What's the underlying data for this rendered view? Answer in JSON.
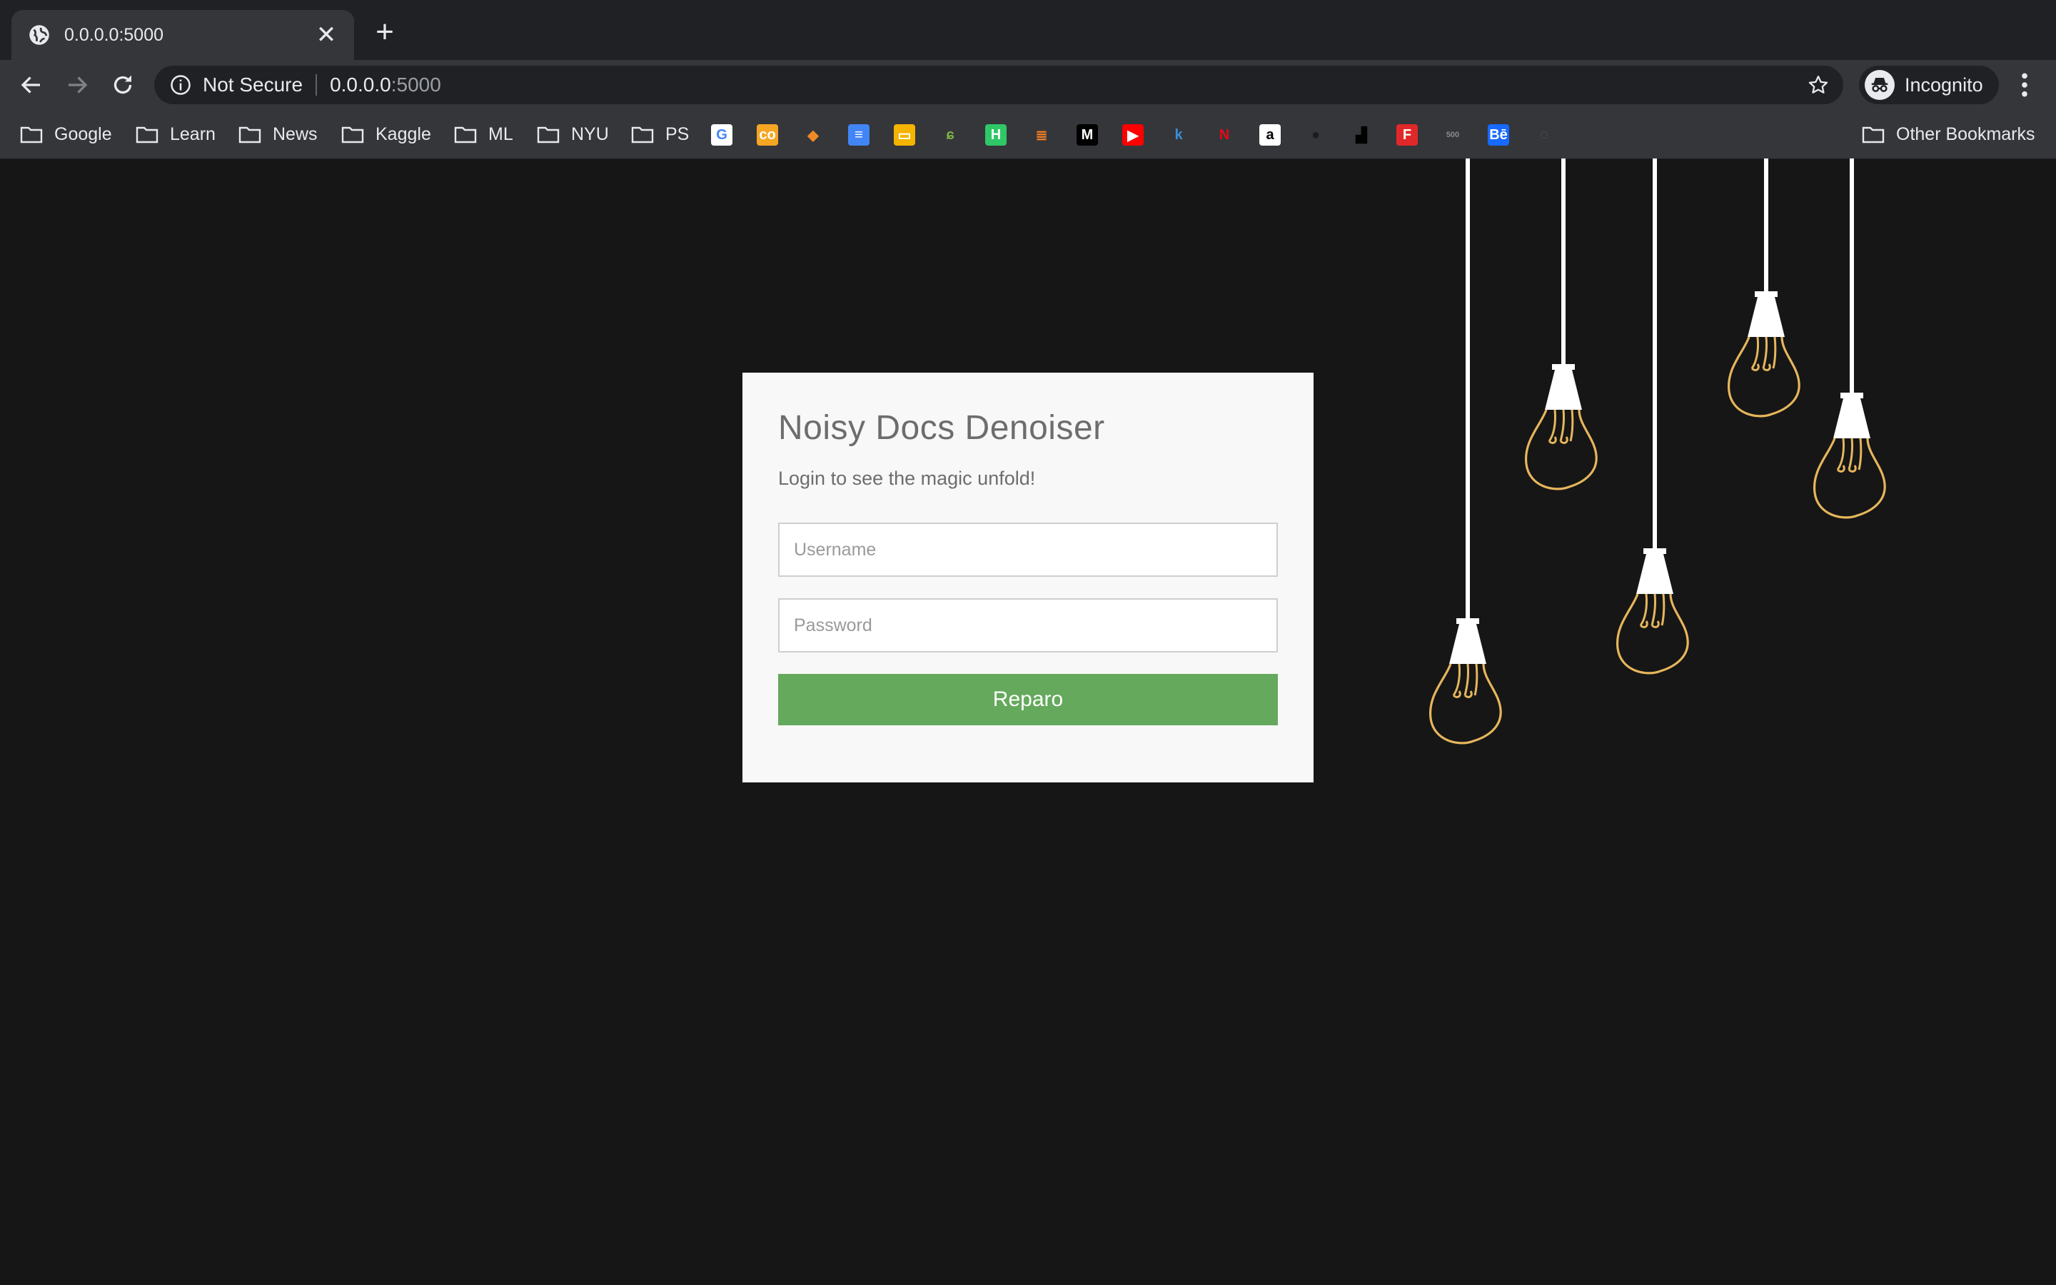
{
  "browser": {
    "tab_title": "0.0.0.0:5000",
    "new_tab_glyph": "+",
    "close_glyph": "✕",
    "security_label": "Not Secure",
    "url_host": "0.0.0.0",
    "url_port": ":5000",
    "profile_label": "Incognito"
  },
  "bookmarks": {
    "folders": [
      "Google",
      "Learn",
      "News",
      "Kaggle",
      "ML",
      "NYU",
      "PS"
    ],
    "other_label": "Other Bookmarks",
    "icons": [
      {
        "name": "google-icon",
        "glyph": "G",
        "bg": "#ffffff",
        "fg": "#4285f4"
      },
      {
        "name": "coursera-icon",
        "glyph": "co",
        "bg": "#f5a623",
        "fg": "#ffffff"
      },
      {
        "name": "cube-icon",
        "glyph": "◆",
        "bg": "#35363a",
        "fg": "#f08a24"
      },
      {
        "name": "docs-icon",
        "glyph": "≡",
        "bg": "#4285f4",
        "fg": "#ffffff"
      },
      {
        "name": "slides-icon",
        "glyph": "▭",
        "bg": "#f4b400",
        "fg": "#ffffff"
      },
      {
        "name": "leaf-icon",
        "glyph": "ɕ",
        "bg": "#35363a",
        "fg": "#7cb342"
      },
      {
        "name": "hackerrank-icon",
        "glyph": "H",
        "bg": "#2ec866",
        "fg": "#ffffff"
      },
      {
        "name": "stackoverflow-icon",
        "glyph": "≣",
        "bg": "#35363a",
        "fg": "#f48024"
      },
      {
        "name": "medium-icon",
        "glyph": "M",
        "bg": "#000000",
        "fg": "#ffffff"
      },
      {
        "name": "youtube-icon",
        "glyph": "▶",
        "bg": "#ff0000",
        "fg": "#ffffff"
      },
      {
        "name": "klout-icon",
        "glyph": "k",
        "bg": "#35363a",
        "fg": "#3a8ed8"
      },
      {
        "name": "netflix-icon",
        "glyph": "N",
        "bg": "#35363a",
        "fg": "#e50914"
      },
      {
        "name": "amazon-icon",
        "glyph": "a",
        "bg": "#ffffff",
        "fg": "#000000"
      },
      {
        "name": "github-icon",
        "glyph": "●",
        "bg": "#35363a",
        "fg": "#1b1b1b"
      },
      {
        "name": "unsplash-icon",
        "glyph": "▟",
        "bg": "#35363a",
        "fg": "#000000"
      },
      {
        "name": "flipboard-icon",
        "glyph": "F",
        "bg": "#e12828",
        "fg": "#ffffff"
      },
      {
        "name": "500px-icon",
        "glyph": "500",
        "bg": "#35363a",
        "fg": "#8a8a8a"
      },
      {
        "name": "behance-icon",
        "glyph": "Bē",
        "bg": "#1769ff",
        "fg": "#ffffff"
      },
      {
        "name": "loading-icon",
        "glyph": "◌",
        "bg": "#35363a",
        "fg": "#5f6368"
      }
    ]
  },
  "login": {
    "title": "Noisy Docs Denoiser",
    "subtitle": "Login to see the magic unfold!",
    "username_placeholder": "Username",
    "password_placeholder": "Password",
    "submit_label": "Reparo"
  },
  "colors": {
    "page_bg": "#161616",
    "card_bg": "#f8f8f8",
    "button_bg": "#65a95c",
    "bulb_outline": "#e6b65c"
  }
}
